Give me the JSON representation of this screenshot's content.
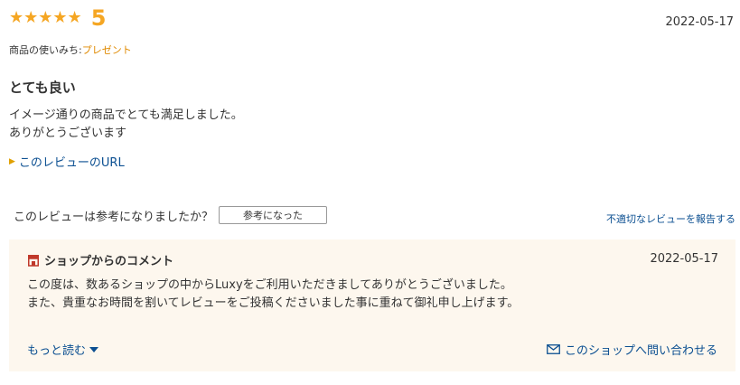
{
  "review": {
    "stars": "★★★★★",
    "rating": 5,
    "score_text": "5",
    "date": "2022-05-17",
    "usage_label": "商品の使いみち:",
    "usage_value": "プレゼント",
    "title": "とても良い",
    "body_line1": "イメージ通りの商品でとても満足しました。",
    "body_line2": "ありがとうございます",
    "link_label": "このレビューのURL"
  },
  "helpful": {
    "question": "このレビューは参考になりましたか？",
    "button_label": "参考になった",
    "report_label": "不適切なレビューを報告する"
  },
  "shop_comment": {
    "title": "ショップからのコメント",
    "date": "2022-05-17",
    "line1": "この度は、数あるショップの中からLuxyをご利用いただきましてありがとうございました。",
    "line2": "また、貴重なお時間を割いてレビューをご投稿くださいました事に重ねて御礼申し上げます。",
    "more_label": "もっと読む",
    "contact_label": "このショップへ問い合わせる"
  },
  "colors": {
    "star": "#f5a623",
    "link": "#0b4f91",
    "usage_value": "#e08a00",
    "shop_bg": "#fdf7ee",
    "shop_icon": "#c0392b"
  },
  "icons": {
    "shop": "shop-icon",
    "mail": "mail-icon",
    "more": "triangle-down-icon",
    "link_caret": "caret-right-icon"
  }
}
